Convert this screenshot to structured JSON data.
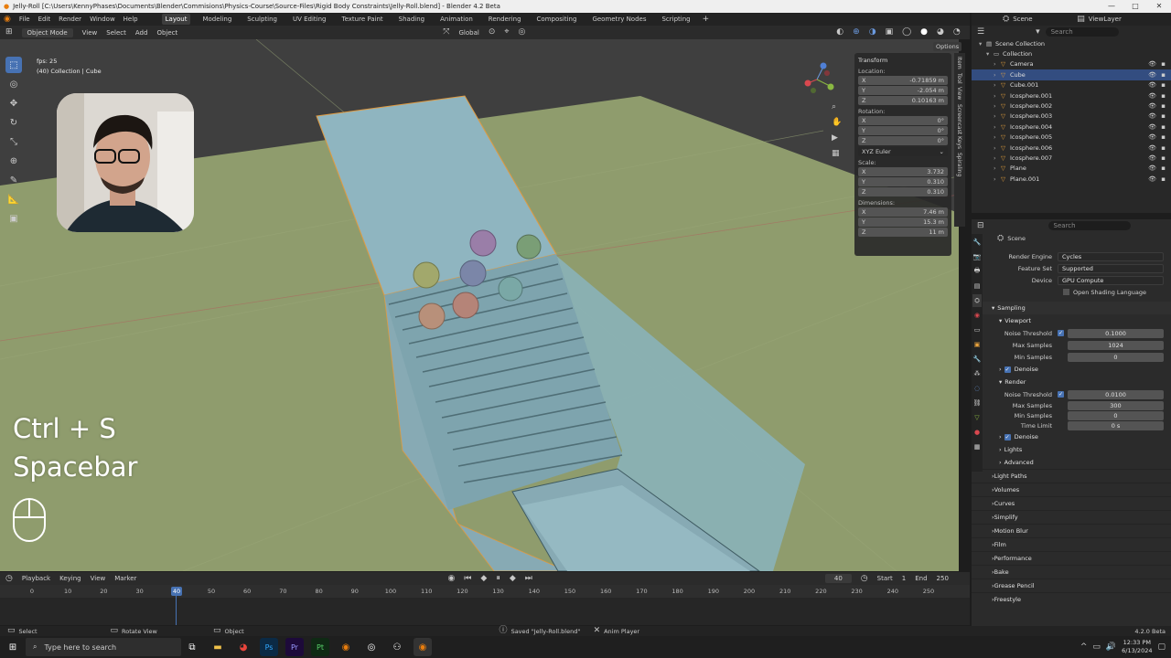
{
  "titlebar": {
    "text": "Jelly-Roll [C:\\Users\\KennyPhases\\Documents\\Blender\\Commisions\\Physics-Course\\Source-Files\\Rigid Body Constraints\\Jelly-Roll.blend] - Blender 4.2 Beta"
  },
  "menus": [
    "File",
    "Edit",
    "Render",
    "Window",
    "Help"
  ],
  "workspaces": [
    "Layout",
    "Modeling",
    "Sculpting",
    "UV Editing",
    "Texture Paint",
    "Shading",
    "Animation",
    "Rendering",
    "Compositing",
    "Geometry Nodes",
    "Scripting"
  ],
  "active_workspace": "Layout",
  "scene_name": "Scene",
  "view_layer": "ViewLayer",
  "viewport_header": {
    "mode": "Object Mode",
    "menus": [
      "View",
      "Select",
      "Add",
      "Object"
    ],
    "orientation": "Global",
    "options": "Options"
  },
  "viewport_info": {
    "fps": "fps: 25",
    "context": "(40) Collection | Cube"
  },
  "key_overlay": {
    "line1": "Ctrl + S",
    "line2": "Spacebar"
  },
  "npanel": {
    "title": "Transform",
    "location_label": "Location:",
    "location": [
      {
        "axis": "X",
        "value": "-0.71859 m"
      },
      {
        "axis": "Y",
        "value": "-2.054 m"
      },
      {
        "axis": "Z",
        "value": "0.10163 m"
      }
    ],
    "rotation_label": "Rotation:",
    "rotation": [
      {
        "axis": "X",
        "value": "0°"
      },
      {
        "axis": "Y",
        "value": "0°"
      },
      {
        "axis": "Z",
        "value": "0°"
      }
    ],
    "rotation_mode": "XYZ Euler",
    "scale_label": "Scale:",
    "scale": [
      {
        "axis": "X",
        "value": "3.732"
      },
      {
        "axis": "Y",
        "value": "0.310"
      },
      {
        "axis": "Z",
        "value": "0.310"
      }
    ],
    "dimensions_label": "Dimensions:",
    "dimensions": [
      {
        "axis": "X",
        "value": "7.46 m"
      },
      {
        "axis": "Y",
        "value": "15.3 m"
      },
      {
        "axis": "Z",
        "value": "11 m"
      }
    ],
    "tabs": [
      "Item",
      "Tool",
      "View",
      "Screencast Keys",
      "Spiraling"
    ]
  },
  "outliner": {
    "search_placeholder": "Search",
    "items": [
      {
        "label": "Scene Collection",
        "indent": 0,
        "selected": false
      },
      {
        "label": "Collection",
        "indent": 1,
        "selected": false
      },
      {
        "label": "Camera",
        "indent": 2,
        "selected": false
      },
      {
        "label": "Cube",
        "indent": 2,
        "selected": true
      },
      {
        "label": "Cube.001",
        "indent": 2,
        "selected": false
      },
      {
        "label": "Icosphere.001",
        "indent": 2,
        "selected": false
      },
      {
        "label": "Icosphere.002",
        "indent": 2,
        "selected": false
      },
      {
        "label": "Icosphere.003",
        "indent": 2,
        "selected": false
      },
      {
        "label": "Icosphere.004",
        "indent": 2,
        "selected": false
      },
      {
        "label": "Icosphere.005",
        "indent": 2,
        "selected": false
      },
      {
        "label": "Icosphere.006",
        "indent": 2,
        "selected": false
      },
      {
        "label": "Icosphere.007",
        "indent": 2,
        "selected": false
      },
      {
        "label": "Plane",
        "indent": 2,
        "selected": false
      },
      {
        "label": "Plane.001",
        "indent": 2,
        "selected": false
      }
    ]
  },
  "properties": {
    "search_placeholder": "Search",
    "context": "Scene",
    "render_engine_label": "Render Engine",
    "render_engine": "Cycles",
    "feature_set_label": "Feature Set",
    "feature_set": "Supported",
    "device_label": "Device",
    "device": "GPU Compute",
    "osl": "Open Shading Language",
    "sampling": "Sampling",
    "viewport": "Viewport",
    "vp_noise_label": "Noise Threshold",
    "vp_noise": "0.1000",
    "vp_max_label": "Max Samples",
    "vp_max": "1024",
    "vp_min_label": "Min Samples",
    "vp_min": "0",
    "denoise": "Denoise",
    "render": "Render",
    "r_noise_label": "Noise Threshold",
    "r_noise": "0.0100",
    "r_max_label": "Max Samples",
    "r_max": "300",
    "r_min_label": "Min Samples",
    "r_min": "0",
    "r_time_label": "Time Limit",
    "r_time": "0 s",
    "denoise2": "Denoise",
    "lights": "Lights",
    "advanced": "Advanced",
    "sections": [
      "Light Paths",
      "Volumes",
      "Curves",
      "Simplify",
      "Motion Blur",
      "Film",
      "Performance",
      "Bake",
      "Grease Pencil",
      "Freestyle"
    ]
  },
  "timeline": {
    "menus": [
      "Playback",
      "Keying",
      "View",
      "Marker"
    ],
    "current_frame": "40",
    "start_label": "Start",
    "start": "1",
    "end_label": "End",
    "end": "250",
    "ticks": [
      "0",
      "10",
      "20",
      "30",
      "40",
      "50",
      "60",
      "70",
      "80",
      "90",
      "100",
      "110",
      "120",
      "130",
      "140",
      "150",
      "160",
      "170",
      "180",
      "190",
      "200",
      "210",
      "220",
      "230",
      "240",
      "250"
    ]
  },
  "status": {
    "select": "Select",
    "rotate": "Rotate View",
    "object": "Object",
    "saved": "Saved \"Jelly-Roll.blend\"",
    "anim": "Anim Player",
    "version": "4.2.0 Beta"
  },
  "taskbar": {
    "search_placeholder": "Type here to search",
    "time": "12:33 PM",
    "date": "6/13/2024"
  },
  "colors": {
    "accent": "#4772b3",
    "ground": "#8f9c6d",
    "glass": "#8fb5c0",
    "selected_row": "#334d80"
  }
}
